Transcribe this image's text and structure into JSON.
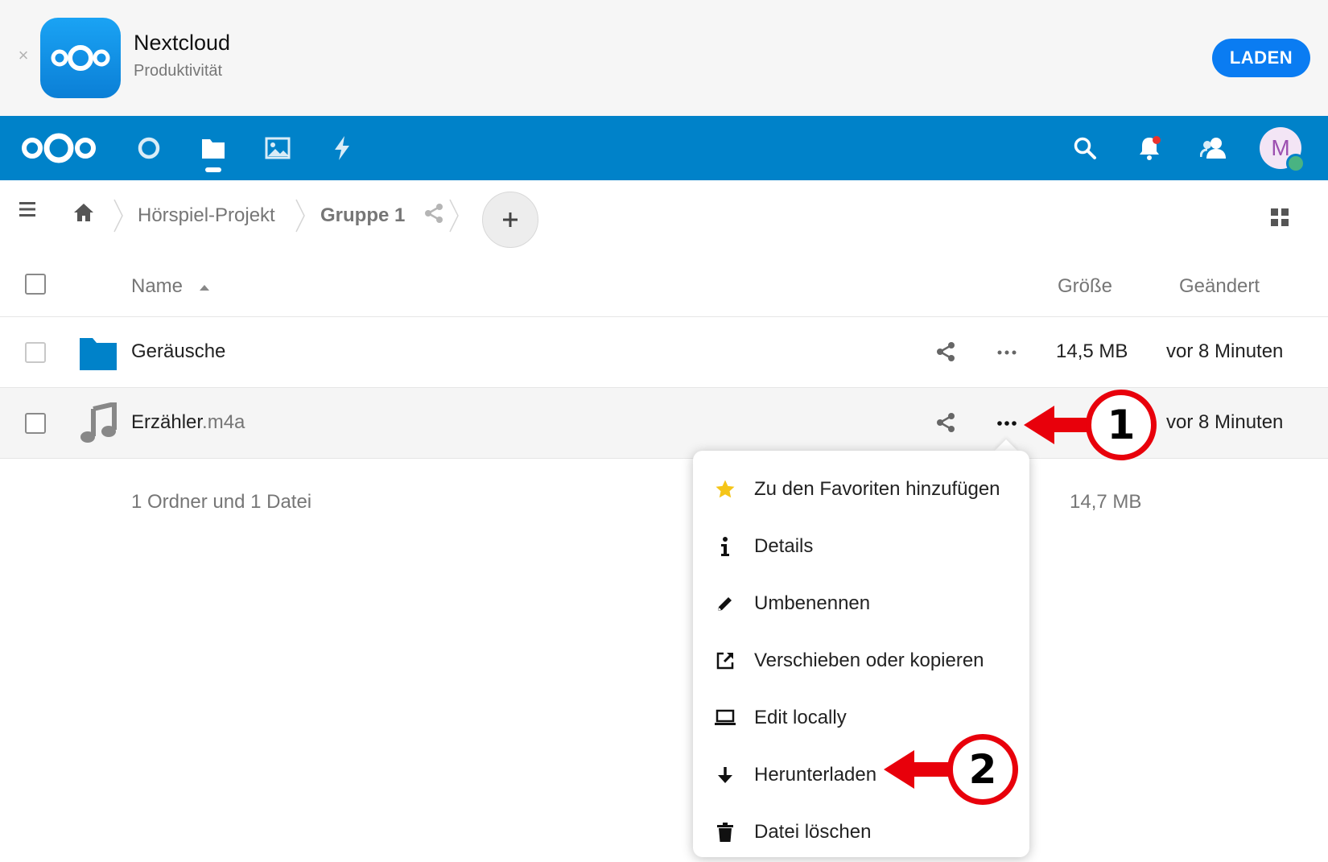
{
  "banner": {
    "app_name": "Nextcloud",
    "category": "Produktivität",
    "button_label": "LADEN",
    "close_glyph": "×"
  },
  "header": {
    "accent_color": "#0082c9",
    "avatar_letter": "M",
    "icons": [
      "nextcloud-logo-icon",
      "dashboard-icon",
      "files-icon",
      "photos-icon",
      "activity-icon",
      "search-icon",
      "notifications-icon",
      "contacts-icon"
    ]
  },
  "breadcrumb": {
    "items": [
      "Hörspiel-Projekt",
      "Gruppe 1"
    ]
  },
  "file_list": {
    "columns": {
      "name": "Name",
      "size": "Größe",
      "modified": "Geändert"
    },
    "rows": [
      {
        "name": "Geräusche",
        "ext": "",
        "type": "folder",
        "size": "14,5 MB",
        "modified": "vor 8 Minuten"
      },
      {
        "name": "Erzähler",
        "ext": ".m4a",
        "type": "audio",
        "size": "",
        "modified": "vor 8 Minuten"
      }
    ],
    "summary": {
      "text": "1 Ordner und 1 Datei",
      "size": "14,7 MB"
    }
  },
  "context_menu": {
    "items": [
      {
        "label": "Zu den Favoriten hinzufügen",
        "icon": "star-icon"
      },
      {
        "label": "Details",
        "icon": "info-icon"
      },
      {
        "label": "Umbenennen",
        "icon": "pencil-icon"
      },
      {
        "label": "Verschieben oder kopieren",
        "icon": "external-link-icon"
      },
      {
        "label": "Edit locally",
        "icon": "laptop-icon"
      },
      {
        "label": "Herunterladen",
        "icon": "download-icon"
      },
      {
        "label": "Datei löschen",
        "icon": "trash-icon"
      }
    ]
  },
  "annotations": {
    "step_1": "1",
    "step_2": "2",
    "color": "#e8000b"
  }
}
